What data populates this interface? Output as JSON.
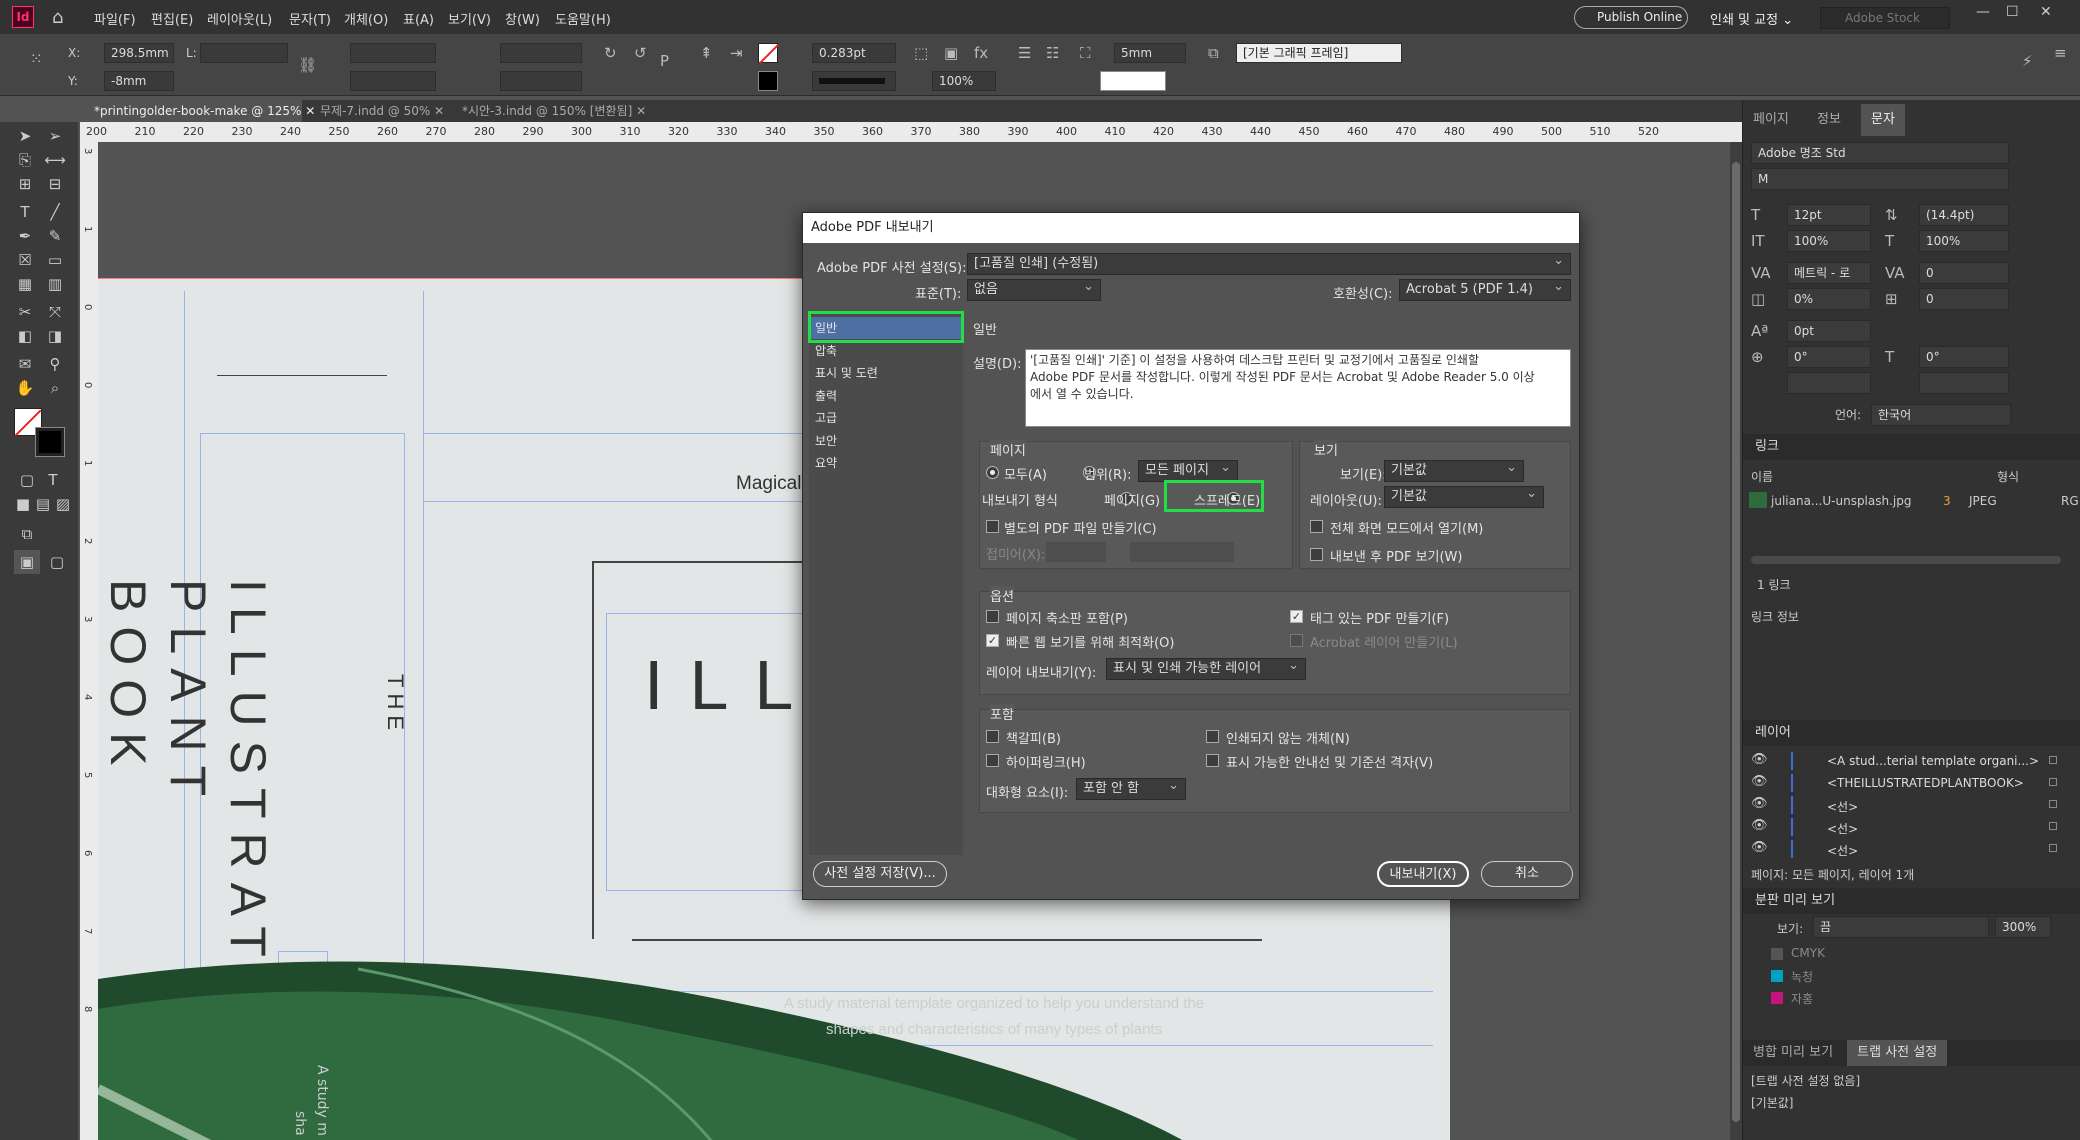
{
  "app": {
    "logo": "Id",
    "home_icon": "home-icon"
  },
  "menu": [
    "파일(F)",
    "편집(E)",
    "레이아웃(L)",
    "문자(T)",
    "개체(O)",
    "표(A)",
    "보기(V)",
    "창(W)",
    "도움말(H)"
  ],
  "publish_label": "Publish Online",
  "workspace": "인쇄 및 교정",
  "stock_placeholder": "Adobe Stock",
  "control": {
    "x": "298.5mm",
    "y": "-8mm",
    "l": "L:",
    "stroke": "0.283pt",
    "zoom_pct": "100%",
    "gap": "5mm",
    "frame_style": "[기본 그래픽 프레임]",
    "x_label": "X:",
    "y_label": "Y:"
  },
  "tabs": [
    {
      "label": "*printingolder-book-make @ 125%"
    },
    {
      "label": "무제-7.indd @ 50%"
    },
    {
      "label": "*시안-3.indd @ 150% [변환됨]"
    }
  ],
  "ruler_h": [
    "200",
    "210",
    "220",
    "230",
    "240",
    "250",
    "260",
    "270",
    "280",
    "290",
    "300",
    "310",
    "320",
    "330",
    "340",
    "350",
    "360",
    "370",
    "380",
    "390",
    "400",
    "410",
    "420",
    "430",
    "440",
    "450",
    "460",
    "470",
    "480",
    "490",
    "500",
    "510",
    "520"
  ],
  "ruler_v": [
    "3",
    "1",
    "0",
    "0",
    "1",
    "2",
    "3",
    "4",
    "5",
    "6",
    "7",
    "8"
  ],
  "document": {
    "vertical_title": "ILLUSTRATED PLANT BOOK",
    "vertical_title_lines": [
      "ILLUSTRATED",
      "PLANT",
      "BOOK"
    ],
    "the": "THE",
    "magical": "Magical",
    "illu": "ILLU",
    "study_line1": "A study material template organized to help you understand the",
    "study_line2": "shapes and characteristics of many types of plants",
    "vert_small_a": "A study m",
    "vert_small_b": "sha"
  },
  "panel": {
    "tabs": [
      "페이지",
      "정보",
      "문자"
    ],
    "font_family": "Adobe 명조 Std",
    "font_style": "M",
    "size": "12pt",
    "leading": "(14.4pt)",
    "vscale": "100%",
    "hscale": "100%",
    "kerning": "메트릭 - 로",
    "tracking": "0",
    "baseline": "0%",
    "tsume": "0",
    "shift": "0pt",
    "rotate": "0°",
    "skew": "0°",
    "lang_label": "언어:",
    "language": "한국어",
    "links_title": "링크",
    "links_header": {
      "name": "이름",
      "format": "형식"
    },
    "link_file": "juliana...U-unsplash.jpg",
    "link_page": "3",
    "link_format": "JPEG",
    "link_extra": "RG",
    "link_count": "1 링크",
    "link_info": "링크 정보",
    "layers_title": "레이어",
    "layers": [
      "<A stud...terial template organi...>",
      "<THEILLUSTRATEDPLANTBOOK>",
      "<선>",
      "<선>",
      "<선>"
    ],
    "layers_footer": "페이지: 모든 페이지, 레이어 1개",
    "sep_title": "분판 미리 보기",
    "sep_view_label": "보기:",
    "sep_view": "끔",
    "sep_zoom": "300%",
    "sep_items": [
      {
        "name": "CMYK",
        "color": "#555555"
      },
      {
        "name": "녹청",
        "color": "#00a0c6"
      },
      {
        "name": "자홍",
        "color": "#c4147e"
      }
    ],
    "trap_tabs": [
      "병합 미리 보기",
      "트랩 사전 설정"
    ],
    "trap_items": [
      "[트랩 사전 설정 없음]",
      "[기본값]"
    ]
  },
  "dialog": {
    "title": "Adobe PDF 내보내기",
    "preset_label": "Adobe PDF 사전 설정(S):",
    "preset": "[고품질 인쇄] (수정됨)",
    "standard_label": "표준(T):",
    "standard": "없음",
    "compat_label": "호환성(C):",
    "compat": "Acrobat 5 (PDF 1.4)",
    "nav": [
      "일반",
      "압축",
      "표시 및 도련",
      "출력",
      "고급",
      "보안",
      "요약"
    ],
    "section_title": "일반",
    "desc_label": "설명(D):",
    "description": "'[고품질 인쇄]' 기준] 이 설정을 사용하여 데스크탑 프린터 및 교정기에서 고품질로 인쇄할 Adobe PDF 문서를 작성합니다. 이렇게 작성된 PDF 문서는 Acrobat 및 Adobe Reader 5.0 이상에서 열 수 있습니다.",
    "desc_lines": [
      "'[고품질 인쇄]' 기준] 이 설정을 사용하여 데스크탑 프린터 및 교정기에서 고품질로 인쇄할",
      "Adobe PDF 문서를 작성합니다. 이렇게 작성된 PDF 문서는 Acrobat 및 Adobe Reader 5.0 이상",
      "에서 열 수 있습니다."
    ],
    "pages_title": "페이지",
    "all_label": "모두(A)",
    "range_label": "범위(R):",
    "range_value": "모든 페이지",
    "export_as_label": "내보내기 형식",
    "pages_radio": "페이지(G)",
    "spreads_radio": "스프레드(E)",
    "separate_pdf": "별도의 PDF 파일 만들기(C)",
    "suffix_label": "접미어(X):",
    "view_title": "보기",
    "view_label": "보기(E):",
    "view_value": "기본값",
    "layout_label": "레이아웃(U):",
    "layout_value": "기본값",
    "fullscreen": "전체 화면 모드에서 열기(M)",
    "view_after": "내보낸 후 PDF 보기(W)",
    "options_title": "옵션",
    "thumbs": "페이지 축소판 포함(P)",
    "fastweb": "빠른 웹 보기를 위해 최적화(O)",
    "tagged": "태그 있는 PDF 만들기(F)",
    "acro_layers": "Acrobat 레이어 만들기(L)",
    "export_layers_label": "레이어 내보내기(Y):",
    "export_layers": "표시 및 인쇄 가능한 레이어",
    "include_title": "포함",
    "bookmarks": "책갈피(B)",
    "hyperlinks": "하이퍼링크(H)",
    "nonprint": "인쇄되지 않는 개체(N)",
    "guides": "표시 가능한 안내선 및 기준선 격자(V)",
    "interactive_label": "대화형 요소(I):",
    "interactive": "포함 안 함",
    "save_preset": "사전 설정 저장(V)...",
    "export_btn": "내보내기(X)",
    "cancel_btn": "취소"
  }
}
